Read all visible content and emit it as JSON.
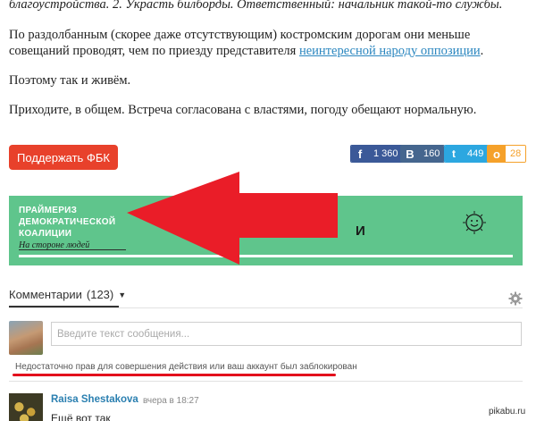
{
  "article": {
    "p0": "благоустройства. 2. Украсть билборды. Ответственный: начальник такой-то службы.",
    "p1": "По раздолбанным (скорее даже отсутствующим) костромским дорогам они меньше",
    "p1b_text": "совещаний проводят, чем по приезду представителя ",
    "p1b_link": "неинтересной народу оппозиции",
    "p1b_tail": ".",
    "p2": "Поэтому так и живём.",
    "p3": "Приходите, в общем. Встреча согласована с властями, погоду обещают нормальную."
  },
  "support_button": "Поддержать ФБК",
  "share": {
    "fb": {
      "icon": "f",
      "count": "1 360",
      "color": "#3b5998"
    },
    "vk": {
      "icon": "В",
      "count": "160",
      "color": "#45668e"
    },
    "tw": {
      "icon": "t",
      "count": "449",
      "color": "#2ca7e0"
    },
    "ok": {
      "icon": "о",
      "count": "28",
      "color": "#f5a12a"
    }
  },
  "banner": {
    "title": "ПРАЙМЕРИЗ\nДЕМОКРАТИЧЕСКОЙ\nКОАЛИЦИИ",
    "subtitle": "На стороне людей",
    "letter": "И",
    "background": "#5fc58c"
  },
  "comments": {
    "title": "Комментарии",
    "count": "(123)",
    "placeholder": "Введите текст сообщения...",
    "error": "Недостаточно прав для совершения действия или ваш аккаунт был заблокирован",
    "items": [
      {
        "author": "Raisa Shestakova",
        "time": "вчера в 18:27",
        "text": "Ещё вот так"
      }
    ]
  },
  "watermark": "pikabu.ru",
  "accent_red": "#e3101c"
}
